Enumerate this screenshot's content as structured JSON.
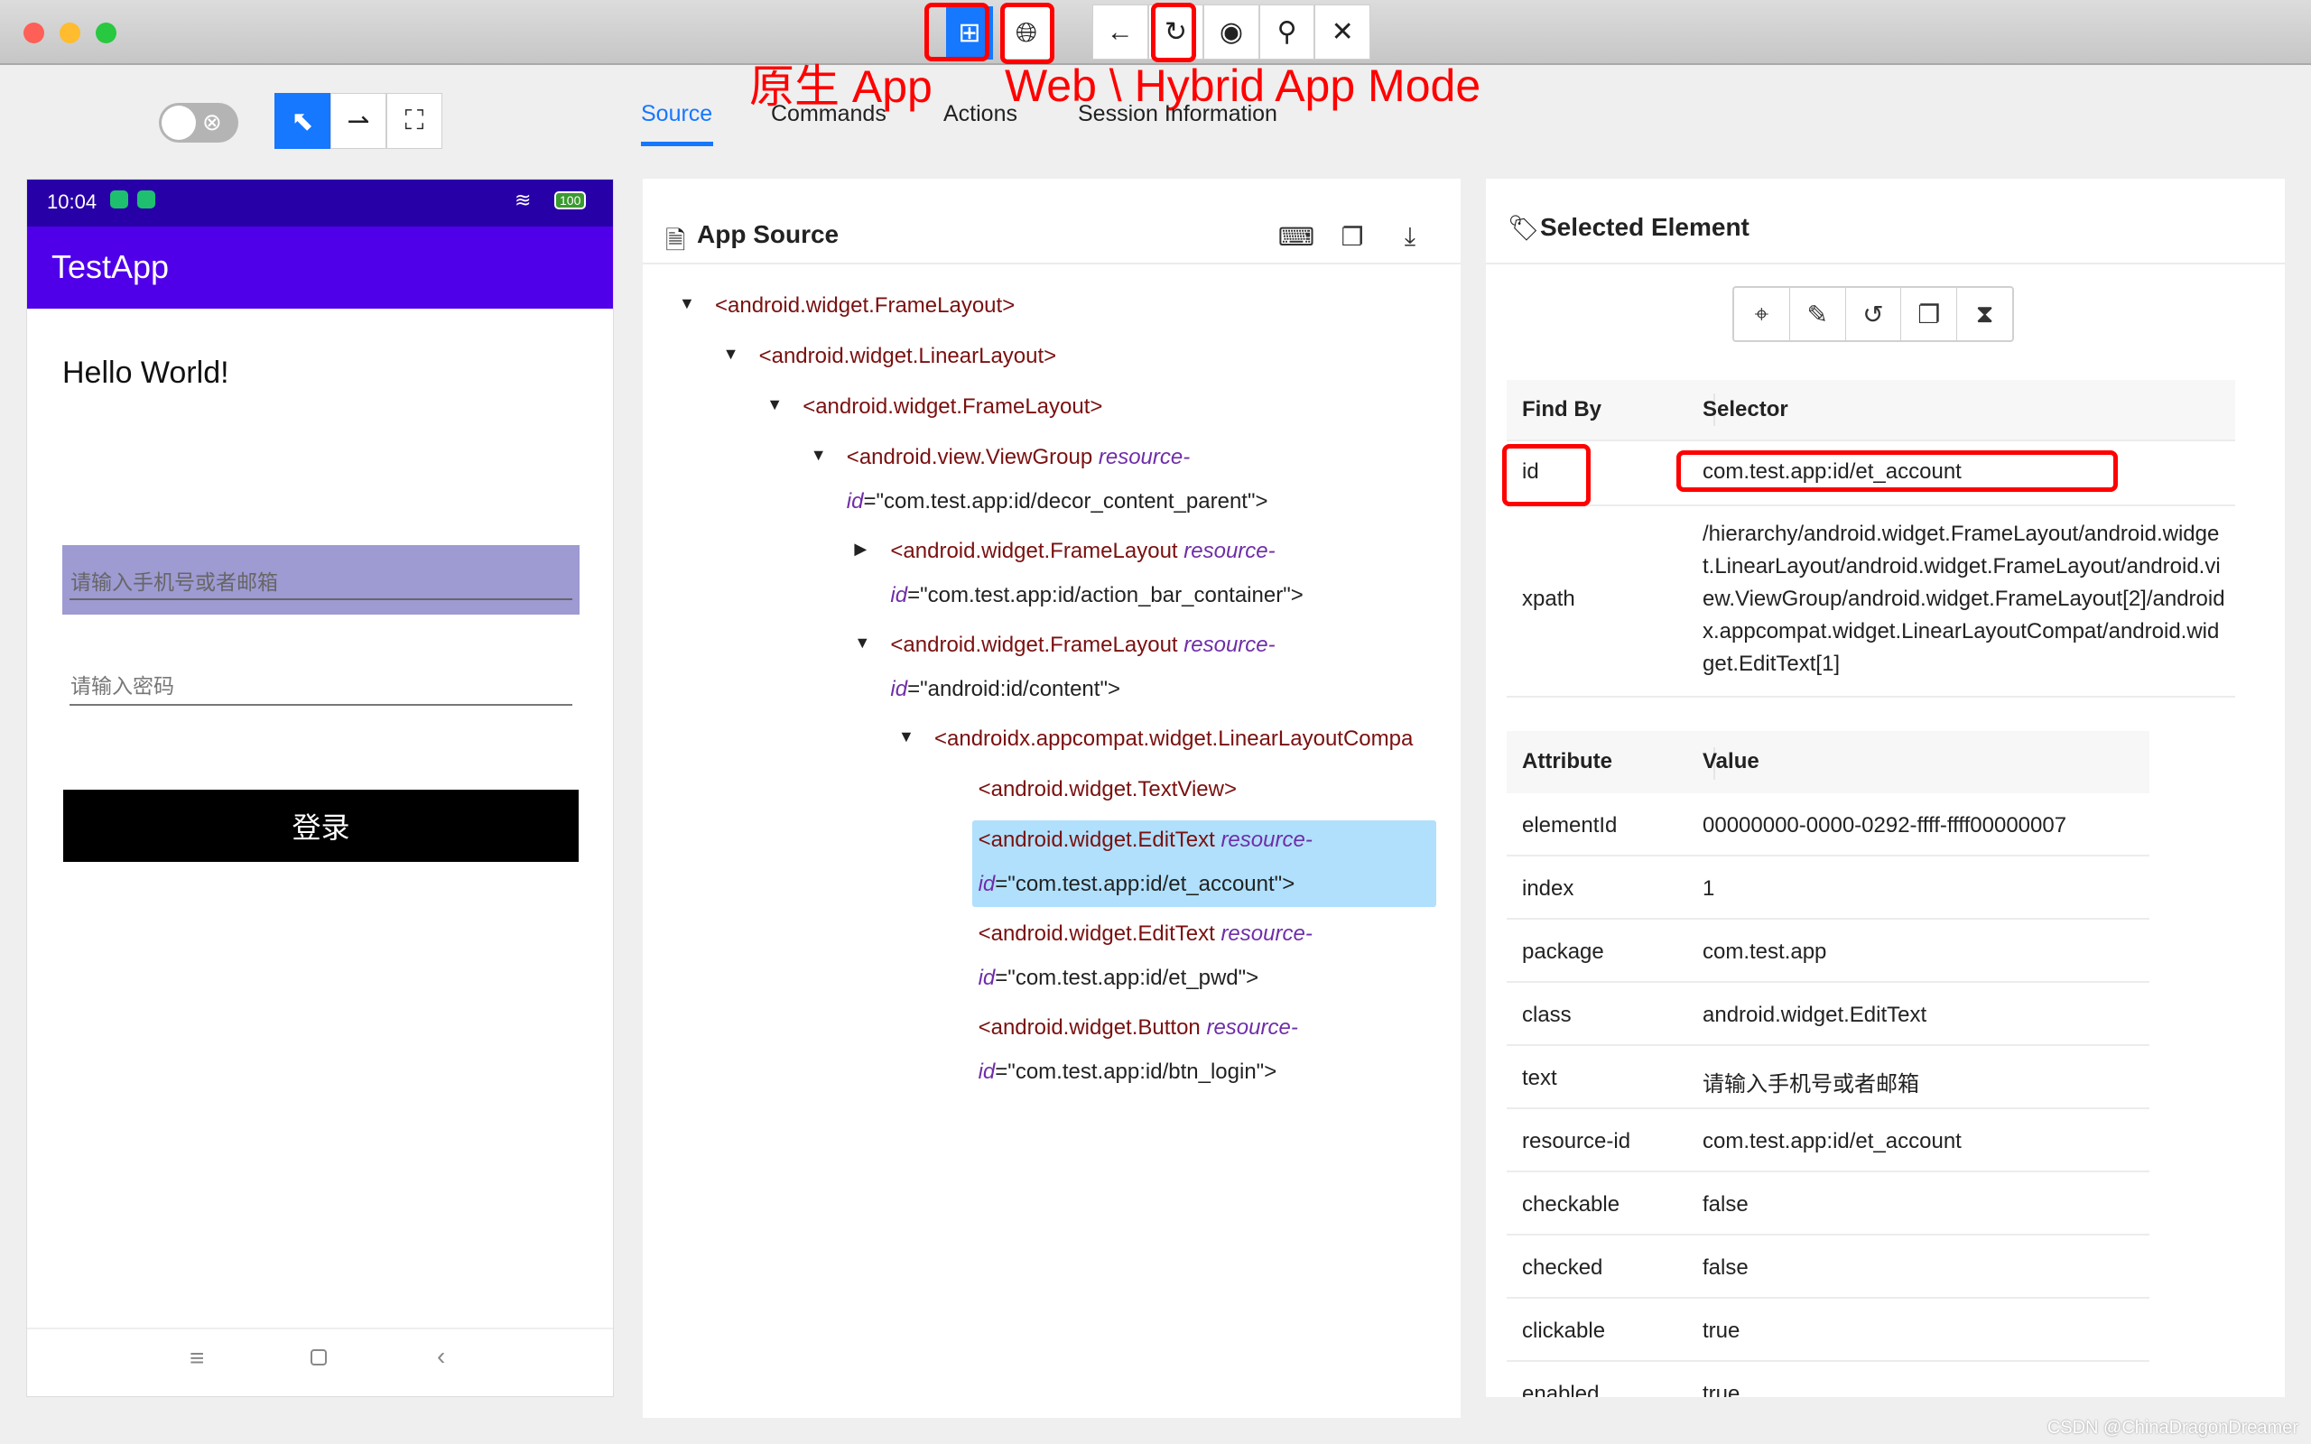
{
  "window": {
    "traffic_lights": [
      "#fe5f57",
      "#febc2e",
      "#28c840"
    ]
  },
  "mode_buttons": [
    {
      "name": "native-app-mode",
      "icon": "grid-icon",
      "active": true
    },
    {
      "name": "web-hybrid-mode",
      "icon": "globe-icon",
      "active": false
    }
  ],
  "nav_buttons": [
    {
      "icon": "arrow-left-icon",
      "glyph": "←"
    },
    {
      "icon": "refresh-icon",
      "glyph": "↻"
    },
    {
      "icon": "eye-icon",
      "glyph": "◉"
    },
    {
      "icon": "search-icon",
      "glyph": "⚲"
    },
    {
      "icon": "close-icon",
      "glyph": "✕"
    }
  ],
  "annotations": {
    "native": "原生 App",
    "web": "Web \\ Hybrid App Mode"
  },
  "tool_buttons": [
    {
      "icon": "select-element-icon",
      "glyph": "⬉",
      "active": true
    },
    {
      "icon": "swipe-icon",
      "glyph": "⇀",
      "active": false
    },
    {
      "icon": "tap-coordinates-icon",
      "glyph": "⛶",
      "active": false
    }
  ],
  "tabs": [
    {
      "label": "Source",
      "active": true
    },
    {
      "label": "Commands",
      "active": false
    },
    {
      "label": "Actions",
      "active": false
    },
    {
      "label": "Session Information",
      "active": false
    }
  ],
  "phone": {
    "time": "10:04",
    "battery": "100",
    "app_title": "TestApp",
    "hello": "Hello World!",
    "account_placeholder": "请输入手机号或者邮箱",
    "password_placeholder": "请输入密码",
    "login_label": "登录",
    "status_bar_color": "#2800a8",
    "app_bar_color": "#4f00e8",
    "highlight_color": "#9e9ad2"
  },
  "source": {
    "title": "App Source",
    "tree": [
      {
        "tag": "android.widget.FrameLayout",
        "attr": "",
        "value": "",
        "toggle": "expanded",
        "depth": 0,
        "selected": false
      },
      {
        "tag": "android.widget.LinearLayout",
        "attr": "",
        "value": "",
        "toggle": "expanded",
        "depth": 1,
        "selected": false
      },
      {
        "tag": "android.widget.FrameLayout",
        "attr": "",
        "value": "",
        "toggle": "expanded",
        "depth": 2,
        "selected": false
      },
      {
        "tag": "android.view.ViewGroup",
        "attr": "resource-id",
        "value": "com.test.app:id/decor_content_parent",
        "toggle": "expanded",
        "depth": 3,
        "selected": false
      },
      {
        "tag": "android.widget.FrameLayout",
        "attr": "resource-id",
        "value": "com.test.app:id/action_bar_container",
        "toggle": "collapsed",
        "depth": 4,
        "selected": false
      },
      {
        "tag": "android.widget.FrameLayout",
        "attr": "resource-id",
        "value": "android:id/content",
        "toggle": "expanded",
        "depth": 4,
        "selected": false
      },
      {
        "tag": "androidx.appcompat.widget.LinearLayoutCompa",
        "attr": "",
        "value": "",
        "toggle": "expanded",
        "depth": 5,
        "selected": false,
        "truncated": true
      },
      {
        "tag": "android.widget.TextView",
        "attr": "",
        "value": "",
        "toggle": "",
        "depth": 6,
        "selected": false
      },
      {
        "tag": "android.widget.EditText",
        "attr": "resource-id",
        "value": "com.test.app:id/et_account",
        "toggle": "",
        "depth": 6,
        "selected": true
      },
      {
        "tag": "android.widget.EditText",
        "attr": "resource-id",
        "value": "com.test.app:id/et_pwd",
        "toggle": "",
        "depth": 6,
        "selected": false
      },
      {
        "tag": "android.widget.Button",
        "attr": "resource-id",
        "value": "com.test.app:id/btn_login",
        "toggle": "",
        "depth": 6,
        "selected": false
      }
    ],
    "selected_color": "#b0e0fc"
  },
  "selected": {
    "title": "Selected Element",
    "find_by_header": "Find By",
    "selector_header": "Selector",
    "find_rows": [
      {
        "by": "id",
        "selector": "com.test.app:id/et_account"
      },
      {
        "by": "xpath",
        "selector": "/hierarchy/android.widget.FrameLayout/android.widget.LinearLayout/android.widget.FrameLayout/android.view.ViewGroup/android.widget.FrameLayout[2]/androidx.appcompat.widget.LinearLayoutCompat/android.widget.EditText[1]"
      }
    ],
    "attribute_header": "Attribute",
    "value_header": "Value",
    "attributes": [
      {
        "name": "elementId",
        "value": "00000000-0000-0292-ffff-ffff00000007"
      },
      {
        "name": "index",
        "value": "1"
      },
      {
        "name": "package",
        "value": "com.test.app"
      },
      {
        "name": "class",
        "value": "android.widget.EditText"
      },
      {
        "name": "text",
        "value": "请输入手机号或者邮箱"
      },
      {
        "name": "resource-id",
        "value": "com.test.app:id/et_account"
      },
      {
        "name": "checkable",
        "value": "false"
      },
      {
        "name": "checked",
        "value": "false"
      },
      {
        "name": "clickable",
        "value": "true"
      },
      {
        "name": "enabled",
        "value": "true"
      }
    ]
  },
  "watermark": "CSDN @ChinaDragonDreamer",
  "accent": "#1677ff",
  "annotation_color": "#ff0000"
}
